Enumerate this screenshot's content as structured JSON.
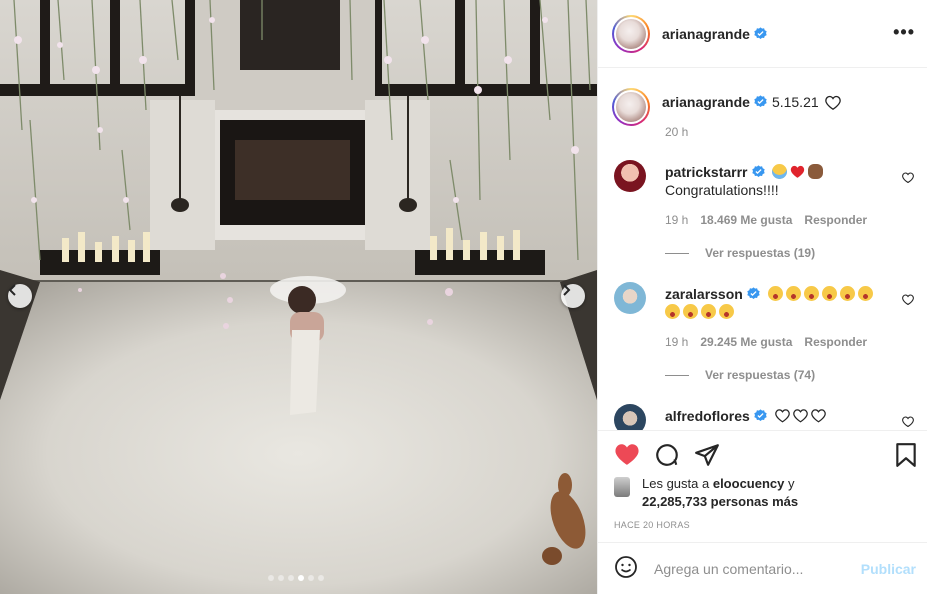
{
  "post": {
    "author": "arianagrande",
    "more_label": "•••",
    "carousel": {
      "total_slides": 6,
      "active_slide": 4
    }
  },
  "caption": {
    "author": "arianagrande",
    "text": "5.15.21",
    "time": "20 h"
  },
  "comments": [
    {
      "author": "patrickstarrr",
      "text": "Congratulations!!!!",
      "emojis": [
        "crying-face-emoji",
        "red-heart-emoji",
        "clapping-hands-emoji"
      ],
      "time": "19 h",
      "likes": "18.469 Me gusta",
      "reply_label": "Responder",
      "view_replies": "Ver respuestas (19)",
      "avatar_color": "#7a1420"
    },
    {
      "author": "zaralarsson",
      "text": "",
      "emojis": [
        "heart-eyes-emoji",
        "heart-eyes-emoji",
        "heart-eyes-emoji",
        "heart-eyes-emoji",
        "heart-eyes-emoji",
        "heart-eyes-emoji",
        "heart-eyes-emoji",
        "heart-eyes-emoji",
        "heart-eyes-emoji",
        "heart-eyes-emoji"
      ],
      "time": "19 h",
      "likes": "29.245 Me gusta",
      "reply_label": "Responder",
      "view_replies": "Ver respuestas (74)",
      "avatar_color": "#7fb7d6"
    },
    {
      "author": "alfredoflores",
      "text": "",
      "emojis": [
        "white-heart",
        "white-heart",
        "white-heart"
      ],
      "avatar_color": "#2c4660"
    }
  ],
  "actions": {
    "liked_prefix": "Les gusta a",
    "liked_user": "eloocuency",
    "liked_and": "y",
    "liked_count": "22,285,733 personas más",
    "posted_ago": "Hace 20 horas"
  },
  "comment_input": {
    "placeholder": "Agrega un comentario...",
    "post_label": "Publicar"
  },
  "colors": {
    "verified": "#3897f0",
    "liked_heart": "#ed4956",
    "publish_disabled": "#b2dffc",
    "secondary_text": "#8e8e8e"
  }
}
